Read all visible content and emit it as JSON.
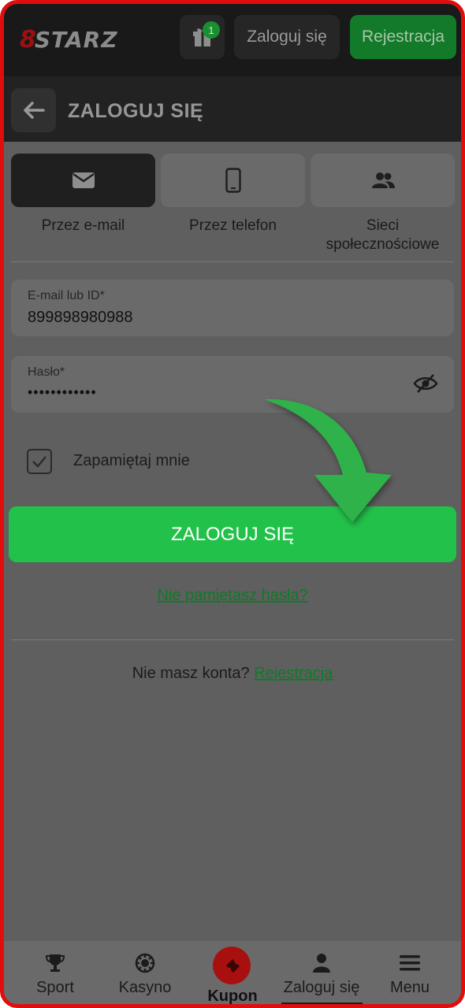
{
  "header": {
    "logo_prefix": "8",
    "logo_text": "STARZ",
    "gift_badge": "1",
    "login_label": "Zaloguj się",
    "register_label": "Rejestracja"
  },
  "titlebar": {
    "title": "ZALOGUJ SIĘ"
  },
  "tabs": [
    {
      "label": "Przez e-mail",
      "icon": "envelope-icon",
      "active": true
    },
    {
      "label": "Przez telefon",
      "icon": "phone-icon",
      "active": false
    },
    {
      "label": "Sieci społecznościowe",
      "icon": "users-icon",
      "active": false
    }
  ],
  "form": {
    "email_label": "E-mail lub ID*",
    "email_value": "899898980988",
    "password_label": "Hasło*",
    "password_value": "••••••••••••",
    "remember_label": "Zapamiętaj mnie",
    "remember_checked": true,
    "submit_label": "ZALOGUJ SIĘ",
    "forgot_label": "Nie pamiętasz hasła?",
    "no_account_label": "Nie masz konta?",
    "register_link": "Rejestracja"
  },
  "bottom_nav": {
    "items": [
      {
        "label": "Sport",
        "icon": "trophy-icon"
      },
      {
        "label": "Kasyno",
        "icon": "casino-chip-icon"
      },
      {
        "label": "Kupon",
        "icon": "ticket-icon"
      },
      {
        "label": "Zaloguj się",
        "icon": "user-icon"
      },
      {
        "label": "Menu",
        "icon": "hamburger-icon"
      }
    ]
  },
  "colors": {
    "accent_green": "#22c14a",
    "link_green": "#0f7a28",
    "brand_red": "#e00d0d",
    "arrow_green": "#2fb24a"
  }
}
